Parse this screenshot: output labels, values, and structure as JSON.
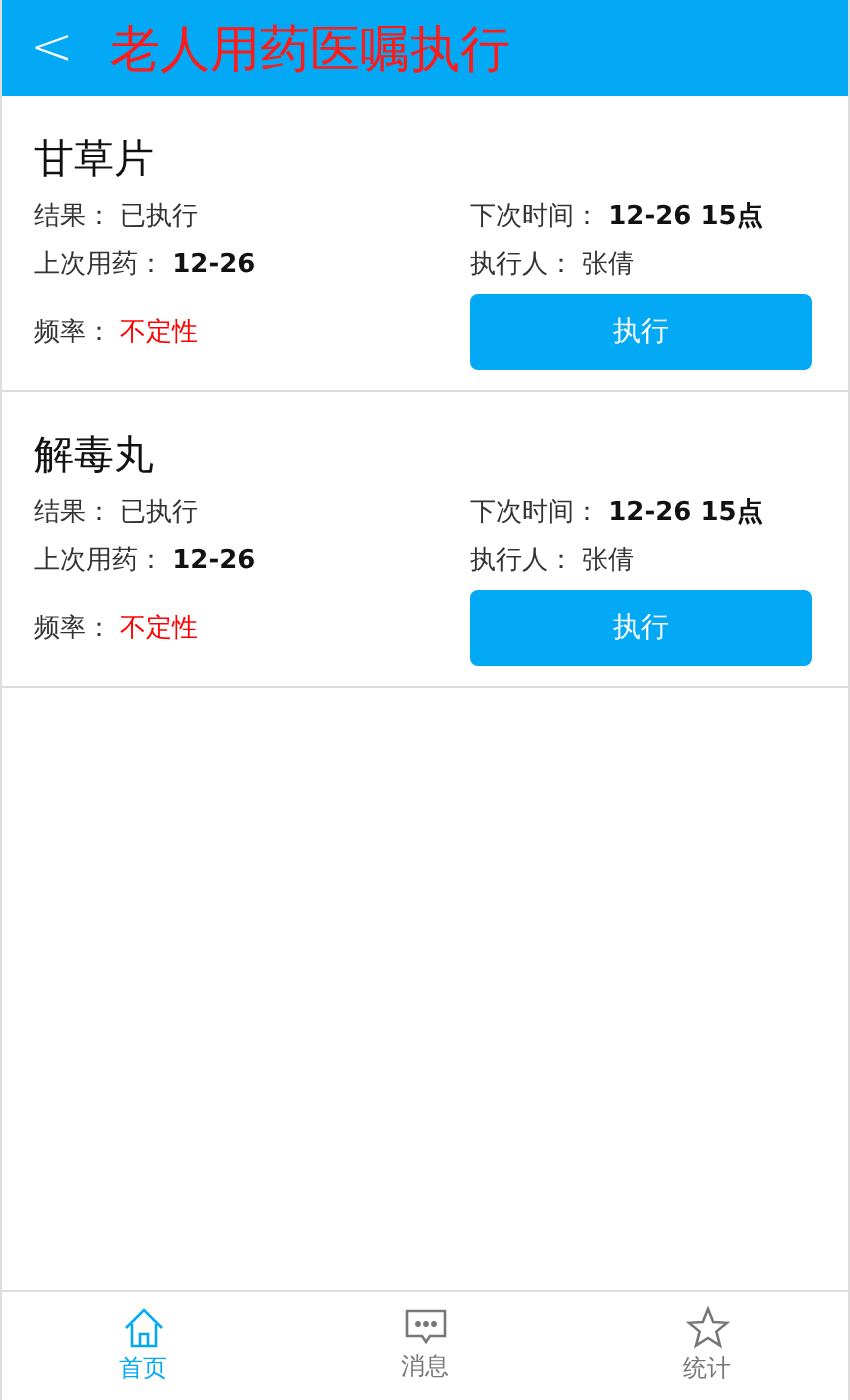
{
  "header": {
    "back_icon": "<",
    "title": "老人用药医嘱执行"
  },
  "orders": [
    {
      "name": "甘草片",
      "fields": [
        {
          "label": "结果：",
          "value": "已执行"
        },
        {
          "label": "下次时间：",
          "value": "12-26 15点"
        },
        {
          "label": "上次用药：",
          "value": "12-26"
        },
        {
          "label": "执行人：",
          "value": "张倩"
        },
        {
          "label": "频率：",
          "value": "不定性"
        }
      ],
      "button": "执行"
    },
    {
      "name": "解毒丸",
      "fields": [
        {
          "label": "结果：",
          "value": "已执行"
        },
        {
          "label": "下次时间：",
          "value": "12-26 15点"
        },
        {
          "label": "上次用药：",
          "value": "12-26"
        },
        {
          "label": "执行人：",
          "value": "张倩"
        },
        {
          "label": "频率：",
          "value": "不定性"
        }
      ],
      "button": "执行"
    }
  ],
  "tabs": [
    {
      "label": "首页",
      "selected": true
    },
    {
      "label": "消息",
      "selected": false
    },
    {
      "label": "统计",
      "selected": false
    }
  ]
}
